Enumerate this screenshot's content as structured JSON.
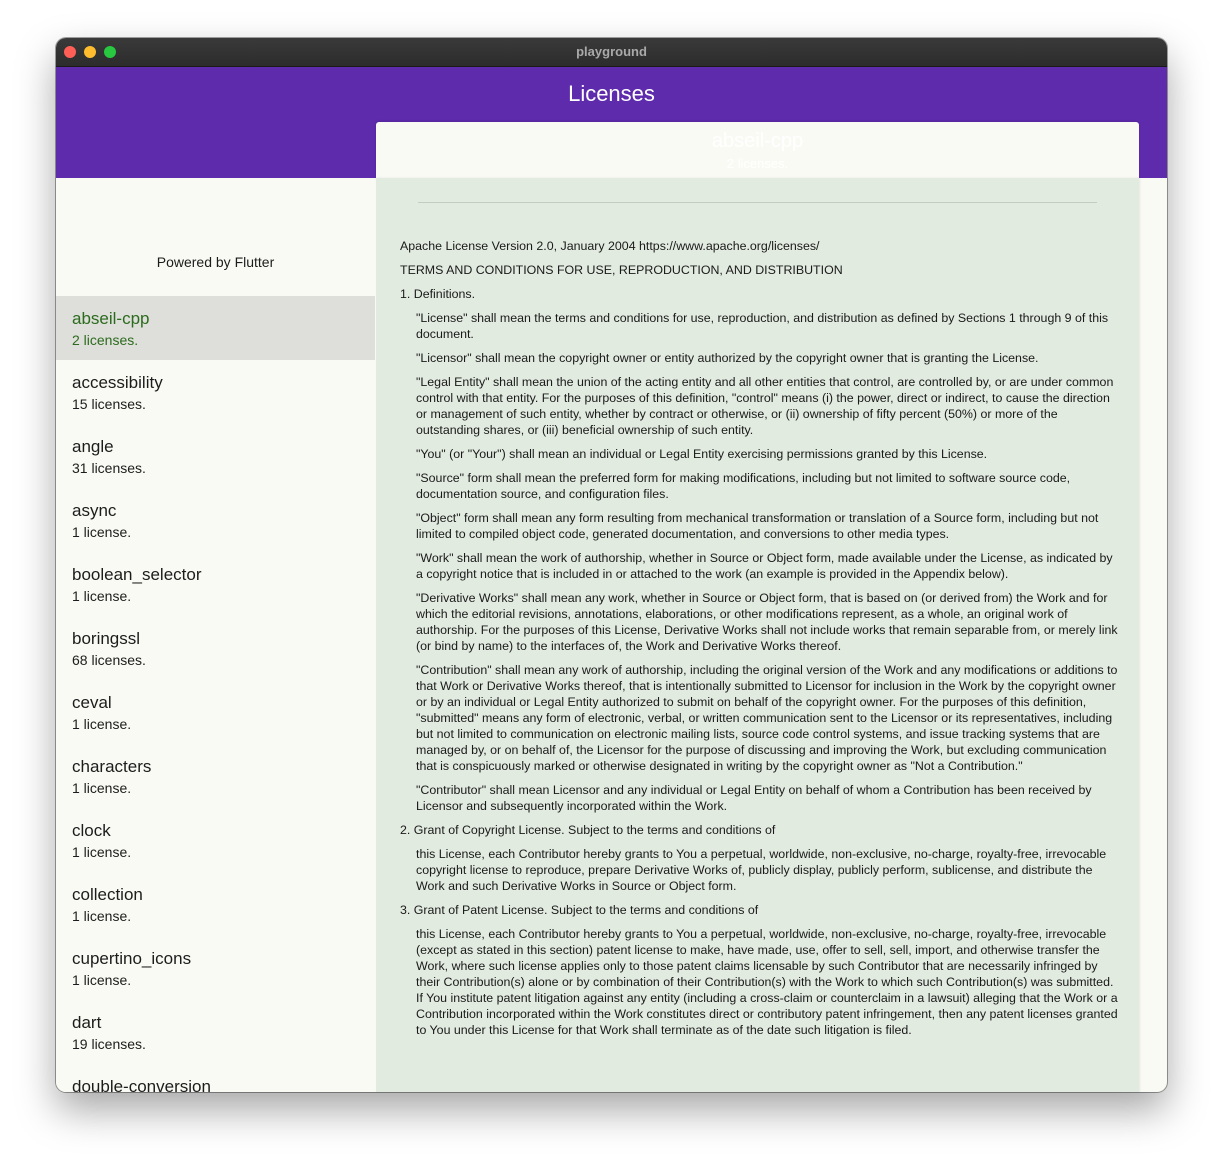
{
  "window": {
    "title": "playground"
  },
  "appbar": {
    "title": "Licenses"
  },
  "sidebar": {
    "powered_by": "Powered by Flutter",
    "packages": [
      {
        "name": "abseil-cpp",
        "count": "2 licenses.",
        "selected": true
      },
      {
        "name": "accessibility",
        "count": "15 licenses."
      },
      {
        "name": "angle",
        "count": "31 licenses."
      },
      {
        "name": "async",
        "count": "1 license."
      },
      {
        "name": "boolean_selector",
        "count": "1 license."
      },
      {
        "name": "boringssl",
        "count": "68 licenses."
      },
      {
        "name": "ceval",
        "count": "1 license."
      },
      {
        "name": "characters",
        "count": "1 license."
      },
      {
        "name": "clock",
        "count": "1 license."
      },
      {
        "name": "collection",
        "count": "1 license."
      },
      {
        "name": "cupertino_icons",
        "count": "1 license."
      },
      {
        "name": "dart",
        "count": "19 licenses."
      },
      {
        "name": "double-conversion",
        "count": ""
      }
    ]
  },
  "detail": {
    "package_name": "abseil-cpp",
    "license_count": "2 licenses.",
    "paragraphs": [
      {
        "text": "Apache License Version 2.0, January 2004 https://www.apache.org/licenses/",
        "indent": false
      },
      {
        "text": "TERMS AND CONDITIONS FOR USE, REPRODUCTION, AND DISTRIBUTION",
        "indent": false
      },
      {
        "text": "1. Definitions.",
        "indent": false
      },
      {
        "text": "\"License\" shall mean the terms and conditions for use, reproduction, and distribution as defined by Sections 1 through 9 of this document.",
        "indent": true
      },
      {
        "text": "\"Licensor\" shall mean the copyright owner or entity authorized by the copyright owner that is granting the License.",
        "indent": true
      },
      {
        "text": "\"Legal Entity\" shall mean the union of the acting entity and all other entities that control, are controlled by, or are under common control with that entity. For the purposes of this definition, \"control\" means (i) the power, direct or indirect, to cause the direction or management of such entity, whether by contract or otherwise, or (ii) ownership of fifty percent (50%) or more of the outstanding shares, or (iii) beneficial ownership of such entity.",
        "indent": true
      },
      {
        "text": "\"You\" (or \"Your\") shall mean an individual or Legal Entity exercising permissions granted by this License.",
        "indent": true
      },
      {
        "text": "\"Source\" form shall mean the preferred form for making modifications, including but not limited to software source code, documentation source, and configuration files.",
        "indent": true
      },
      {
        "text": "\"Object\" form shall mean any form resulting from mechanical transformation or translation of a Source form, including but not limited to compiled object code, generated documentation, and conversions to other media types.",
        "indent": true
      },
      {
        "text": "\"Work\" shall mean the work of authorship, whether in Source or Object form, made available under the License, as indicated by a copyright notice that is included in or attached to the work (an example is provided in the Appendix below).",
        "indent": true
      },
      {
        "text": "\"Derivative Works\" shall mean any work, whether in Source or Object form, that is based on (or derived from) the Work and for which the editorial revisions, annotations, elaborations, or other modifications represent, as a whole, an original work of authorship. For the purposes of this License, Derivative Works shall not include works that remain separable from, or merely link (or bind by name) to the interfaces of, the Work and Derivative Works thereof.",
        "indent": true
      },
      {
        "text": "\"Contribution\" shall mean any work of authorship, including the original version of the Work and any modifications or additions to that Work or Derivative Works thereof, that is intentionally submitted to Licensor for inclusion in the Work by the copyright owner or by an individual or Legal Entity authorized to submit on behalf of the copyright owner. For the purposes of this definition, \"submitted\" means any form of electronic, verbal, or written communication sent to the Licensor or its representatives, including but not limited to communication on electronic mailing lists, source code control systems, and issue tracking systems that are managed by, or on behalf of, the Licensor for the purpose of discussing and improving the Work, but excluding communication that is conspicuously marked or otherwise designated in writing by the copyright owner as \"Not a Contribution.\"",
        "indent": true
      },
      {
        "text": "\"Contributor\" shall mean Licensor and any individual or Legal Entity on behalf of whom a Contribution has been received by Licensor and subsequently incorporated within the Work.",
        "indent": true
      },
      {
        "text": "2. Grant of Copyright License. Subject to the terms and conditions of",
        "indent": false
      },
      {
        "text": "this License, each Contributor hereby grants to You a perpetual, worldwide, non-exclusive, no-charge, royalty-free, irrevocable copyright license to reproduce, prepare Derivative Works of, publicly display, publicly perform, sublicense, and distribute the Work and such Derivative Works in Source or Object form.",
        "indent": true
      },
      {
        "text": "3. Grant of Patent License. Subject to the terms and conditions of",
        "indent": false
      },
      {
        "text": "this License, each Contributor hereby grants to You a perpetual, worldwide, non-exclusive, no-charge, royalty-free, irrevocable (except as stated in this section) patent license to make, have made, use, offer to sell, sell, import, and otherwise transfer the Work, where such license applies only to those patent claims licensable by such Contributor that are necessarily infringed by their Contribution(s) alone or by combination of their Contribution(s) with the Work to which such Contribution(s) was submitted. If You institute patent litigation against any entity (including a cross-claim or counterclaim in a lawsuit) alleging that the Work or a Contribution incorporated within the Work constitutes direct or contributory patent infringement, then any patent licenses granted to You under this License for that Work shall terminate as of the date such litigation is filed.",
        "indent": true
      }
    ]
  },
  "colors": {
    "appbar": "#5e2bad",
    "selected_text": "#2c6b1e",
    "selected_bg": "#dedfda",
    "detail_bg": "#e2ebe0"
  }
}
